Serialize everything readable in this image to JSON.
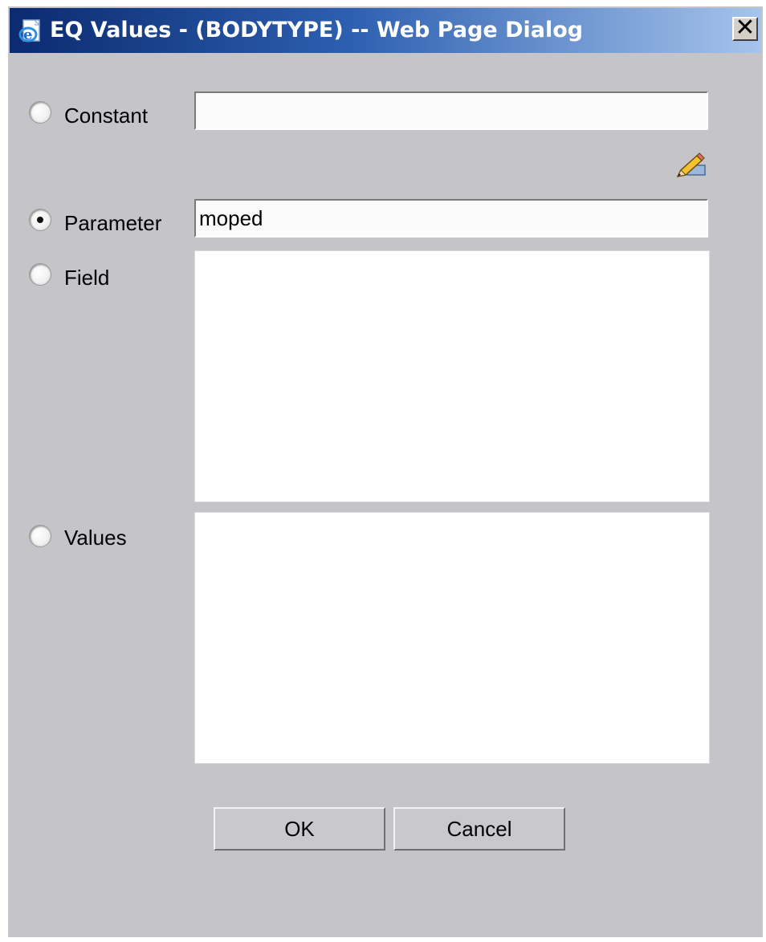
{
  "window": {
    "title": "EQ Values - (BODYTYPE) -- Web Page Dialog",
    "close_label": "✕"
  },
  "form": {
    "constant": {
      "label": "Constant",
      "value": "",
      "checked": false
    },
    "parameter": {
      "label": "Parameter",
      "value": "moped",
      "checked": true
    },
    "field": {
      "label": "Field",
      "checked": false
    },
    "values": {
      "label": "Values",
      "checked": false
    }
  },
  "buttons": {
    "ok_label": "OK",
    "cancel_label": "Cancel"
  },
  "icons": {
    "title": "ie-page-icon",
    "edit": "pencil-edit-icon"
  },
  "colors": {
    "titlebar_start": "#0b2a6f",
    "titlebar_end": "#a6c4ec",
    "dialog_background": "#c5c4c8"
  }
}
